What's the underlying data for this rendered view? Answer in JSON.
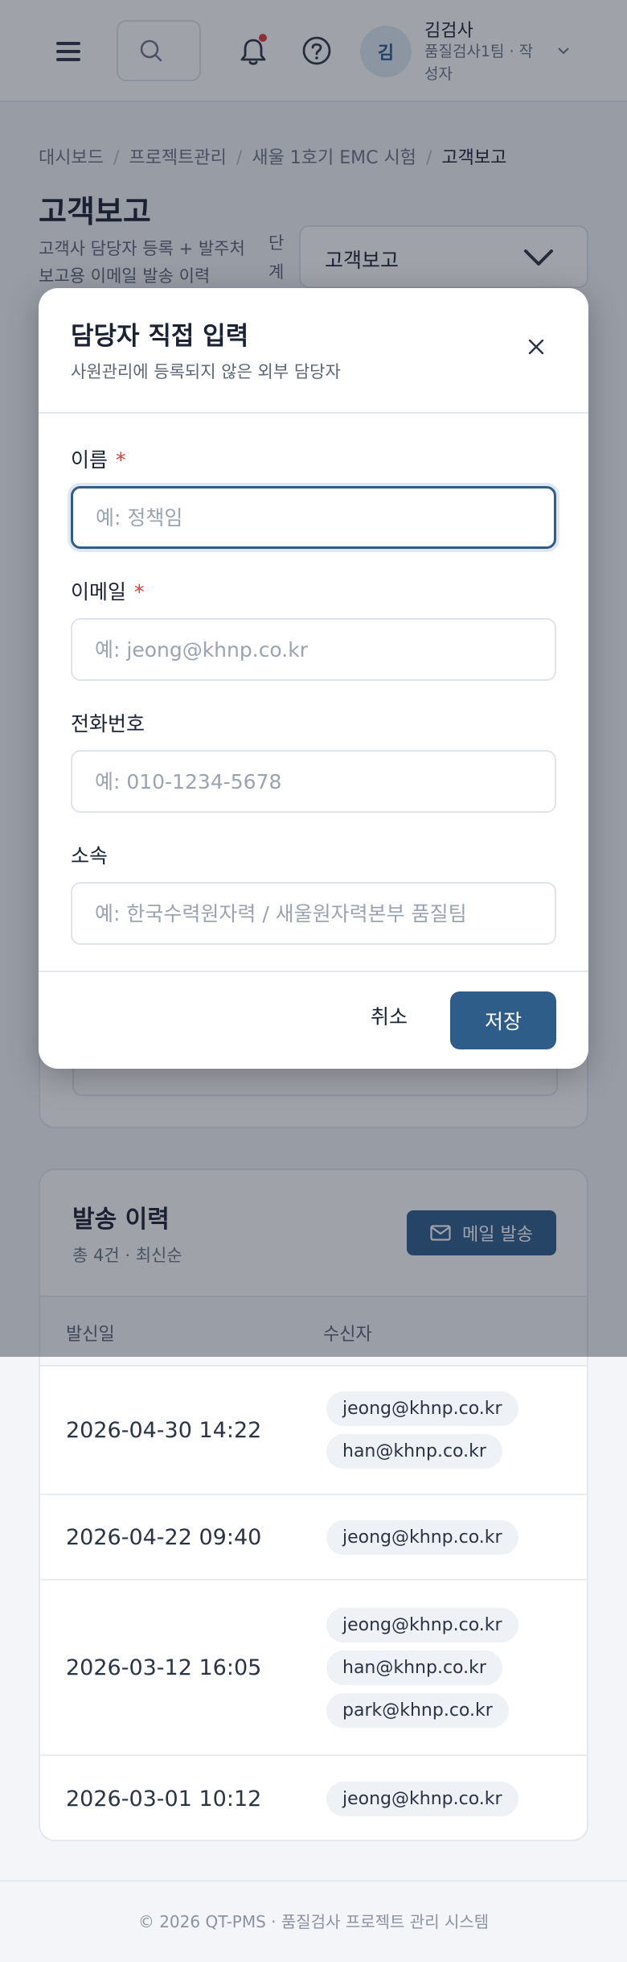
{
  "header": {
    "avatar_initial": "김",
    "user_name": "김검사",
    "user_team": "품질검사1팀 · 작성자"
  },
  "breadcrumb": [
    "대시보드",
    "프로젝트관리",
    "새울 1호기 EMC 시험",
    "고객보고"
  ],
  "page": {
    "title": "고객보고",
    "description": "고객사 담당자 등록 + 발주처 보고용 이메일 발송 이력",
    "stage_label": "단계",
    "stage_value": "고객보고"
  },
  "modal": {
    "title": "담당자 직접 입력",
    "subtitle": "사원관리에 등록되지 않은 외부 담당자",
    "fields": [
      {
        "label": "이름",
        "required": true,
        "placeholder": "예: 정책임",
        "value": ""
      },
      {
        "label": "이메일",
        "required": true,
        "placeholder": "예: jeong@khnp.co.kr",
        "value": ""
      },
      {
        "label": "전화번호",
        "required": false,
        "placeholder": "예: 010-1234-5678",
        "value": ""
      },
      {
        "label": "소속",
        "required": false,
        "placeholder": "예: 한국수력원자력 / 새울원자력본부 품질팀",
        "value": ""
      }
    ],
    "required_mark": "*",
    "cancel_label": "취소",
    "save_label": "저장"
  },
  "history": {
    "title": "발송 이력",
    "subtitle": "총 4건 · 최신순",
    "send_button_label": "메일 발송",
    "columns": [
      "발신일",
      "수신자"
    ],
    "rows": [
      {
        "date": "2026-04-30 14:22",
        "recipients": [
          "jeong@khnp.co.kr",
          "han@khnp.co.kr"
        ]
      },
      {
        "date": "2026-04-22 09:40",
        "recipients": [
          "jeong@khnp.co.kr"
        ]
      },
      {
        "date": "2026-03-12 16:05",
        "recipients": [
          "jeong@khnp.co.kr",
          "han@khnp.co.kr",
          "park@khnp.co.kr"
        ]
      },
      {
        "date": "2026-03-01 10:12",
        "recipients": [
          "jeong@khnp.co.kr"
        ]
      }
    ]
  },
  "footer": "© 2026 QT-PMS · 품질검사 프로젝트 관리 시스템",
  "colors": {
    "accent": "#2f5d8a",
    "required": "#e53935",
    "notification_dot": "#e53935"
  },
  "icons": [
    "menu-icon",
    "search-icon",
    "bell-icon",
    "help-icon",
    "chevron-down-icon",
    "close-icon",
    "mail-icon"
  ]
}
